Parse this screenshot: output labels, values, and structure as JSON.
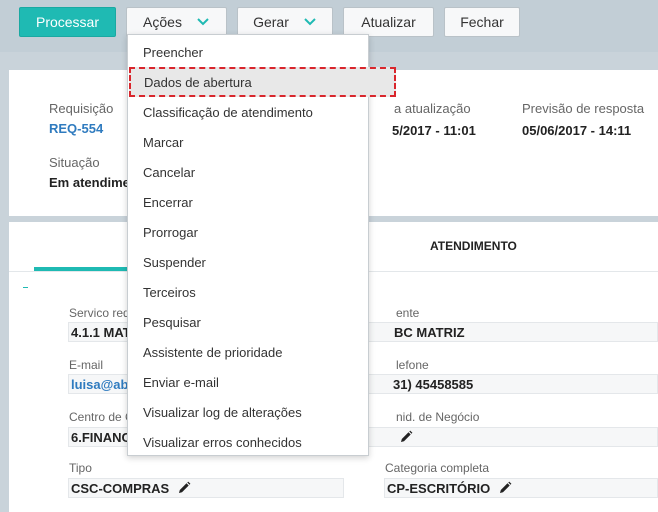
{
  "toolbar": {
    "processar": "Processar",
    "acoes": "Ações",
    "gerar": "Gerar",
    "atualizar": "Atualizar",
    "fechar": "Fechar"
  },
  "summary": {
    "requisicao_label": "Requisição",
    "requisicao_value": "REQ-554",
    "ultima_label": "a atualização",
    "ultima_value": "5/2017 - 11:01",
    "previsao_label": "Previsão de resposta",
    "previsao_value": "05/06/2017 - 14:11",
    "situacao_label": "Situação",
    "situacao_value": "Em atendime"
  },
  "tabs": {
    "atendimento": "ATENDIMENTO"
  },
  "form": {
    "servico_label": "Servico req",
    "servico_value": "4.1.1 MAT",
    "cliente_label": "ente",
    "cliente_value": "BC MATRIZ",
    "email_label": "E-mail",
    "email_value": "luisa@ab",
    "telefone_label": "lefone",
    "telefone_value": "31) 45458585",
    "centro_label": "Centro de C",
    "centro_value": "6.FINANC",
    "unidade_label": "nid. de Negócio",
    "tipo_label": "Tipo",
    "tipo_value": "CSC-COMPRAS",
    "categoria_label": "Categoria completa",
    "categoria_value": "CP-ESCRITÓRIO"
  },
  "menu": {
    "items": [
      "Preencher",
      "Dados de abertura",
      "Classificação de atendimento",
      "Marcar",
      "Cancelar",
      "Encerrar",
      "Prorrogar",
      "Suspender",
      "Terceiros",
      "Pesquisar",
      "Assistente de prioridade",
      "Enviar e-mail",
      "Visualizar log de alterações",
      "Visualizar erros conhecidos"
    ],
    "highlighted_index": 1
  },
  "colors": {
    "accent": "#1fbab3",
    "link": "#2f7bbf",
    "highlight_border": "#d9262c"
  }
}
